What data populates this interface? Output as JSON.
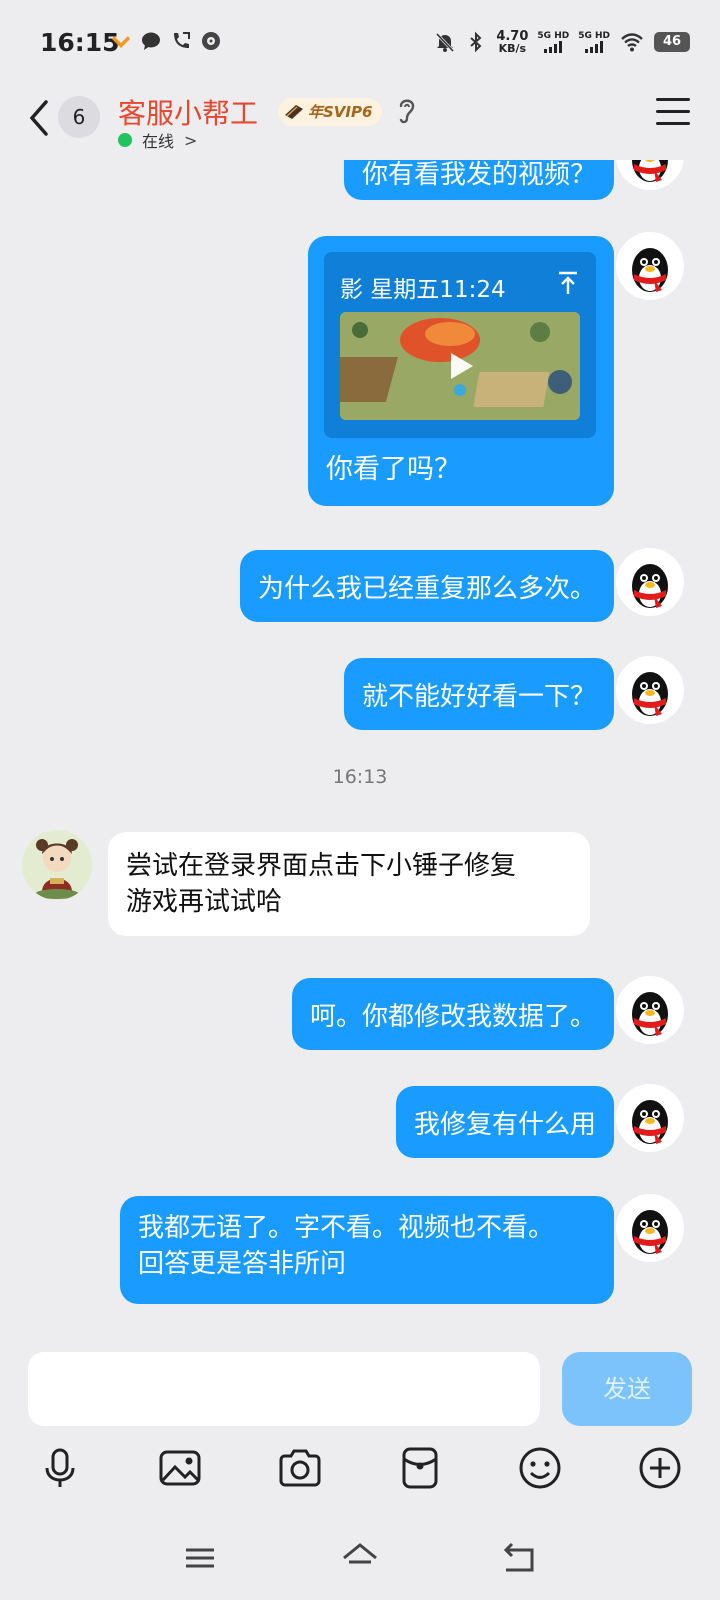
{
  "status_bar": {
    "time": "16:15",
    "net_speed_value": "4.70",
    "net_speed_unit": "KB/s",
    "sim1_label": "5G HD",
    "sim2_label": "5G HD",
    "battery": "46"
  },
  "header": {
    "unread_count": "6",
    "contact_name": "客服小帮工",
    "vip_badge": "年SVIP6",
    "presence": "在线",
    "presence_chevron": ">"
  },
  "messages": {
    "m0": "你有看我发的视频？",
    "video_meta": "影 星期五11:24",
    "video_caption": "你看了吗？",
    "m2": "为什么我已经重复那么多次。",
    "m3": "就不能好好看一下？",
    "timestamp": "16:13",
    "m4_line1": "尝试在登录界面点击下小锤子修复",
    "m4_line2": "游戏再试试哈",
    "m5": "呵。你都修改我数据了。",
    "m6": "我修复有什么用",
    "m7_line1": "我都无语了。字不看。视频也不看。",
    "m7_line2": "回答更是答非所问"
  },
  "input": {
    "send_label": "发送"
  },
  "colors": {
    "outgoing_bubble": "#1a9bff",
    "contact_name": "#e8462d",
    "online": "#22c35e",
    "send_disabled": "#7cc3fb"
  }
}
